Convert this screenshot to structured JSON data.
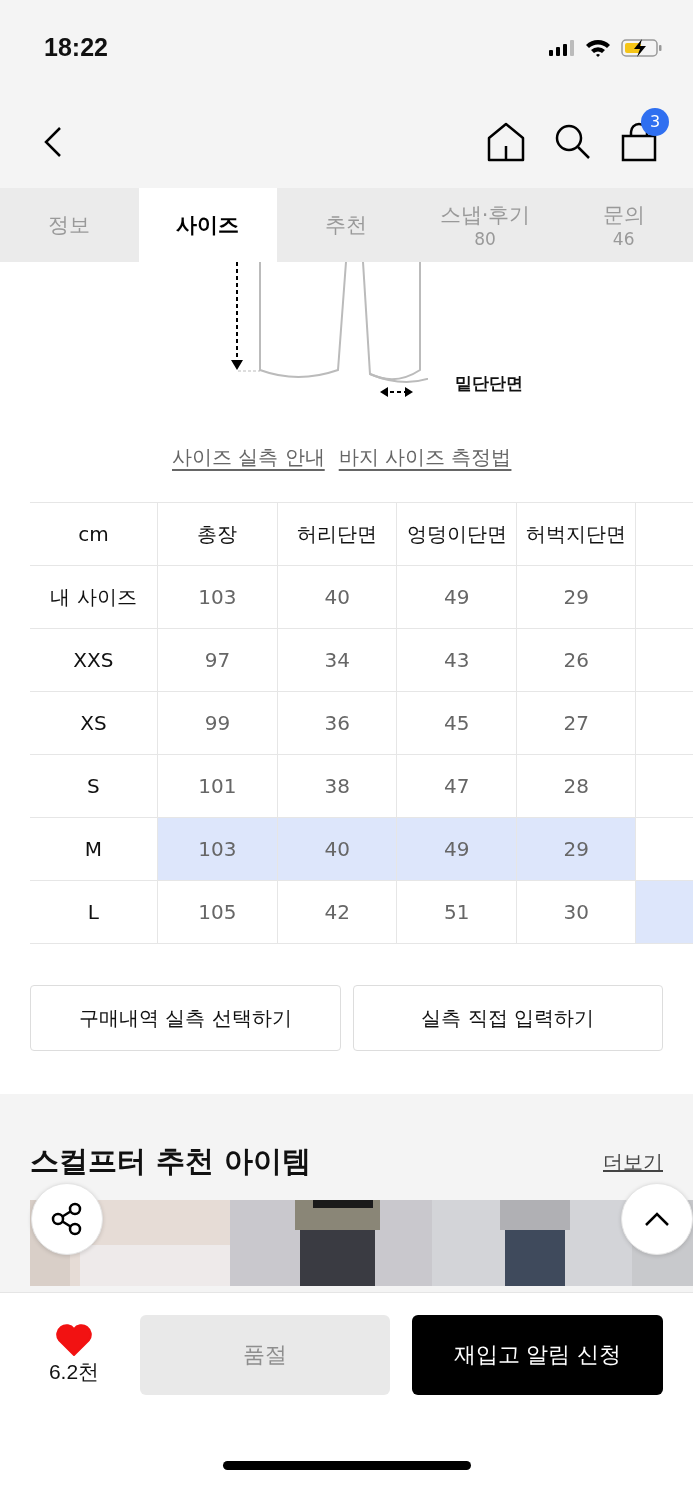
{
  "status_bar": {
    "time": "18:22"
  },
  "nav": {
    "cart_count": "3"
  },
  "tabs": [
    {
      "label": "정보",
      "selected": false
    },
    {
      "label": "사이즈",
      "selected": true
    },
    {
      "label": "추천",
      "selected": false
    },
    {
      "label": "스냅·후기",
      "count": "80",
      "selected": false
    },
    {
      "label": "문의",
      "count": "46",
      "selected": false
    }
  ],
  "diagram": {
    "label": "밑단단면"
  },
  "links": [
    "사이즈 실측 안내",
    "바지 사이즈 측정법"
  ],
  "size_table": {
    "columns": [
      "cm",
      "총장",
      "허리단면",
      "엉덩이단면",
      "허벅지단면"
    ],
    "rows": [
      {
        "label": "내 사이즈",
        "values": [
          "103",
          "40",
          "49",
          "29"
        ],
        "highlighted": false,
        "next_column_highlighted": false
      },
      {
        "label": "XXS",
        "values": [
          "97",
          "34",
          "43",
          "26"
        ],
        "highlighted": false,
        "next_column_highlighted": false
      },
      {
        "label": "XS",
        "values": [
          "99",
          "36",
          "45",
          "27"
        ],
        "highlighted": false,
        "next_column_highlighted": false
      },
      {
        "label": "S",
        "values": [
          "101",
          "38",
          "47",
          "28"
        ],
        "highlighted": false,
        "next_column_highlighted": false
      },
      {
        "label": "M",
        "values": [
          "103",
          "40",
          "49",
          "29"
        ],
        "highlighted": true,
        "next_column_highlighted": false
      },
      {
        "label": "L",
        "values": [
          "105",
          "42",
          "51",
          "30"
        ],
        "highlighted": false,
        "next_column_highlighted": true
      }
    ]
  },
  "actions": [
    "구매내역 실측 선택하기",
    "실측 직접 입력하기"
  ],
  "recommend": {
    "title": "스컬프터 추천 아이템",
    "more": "더보기"
  },
  "bottom_bar": {
    "likes": "6.2천",
    "liked": true,
    "sold_out": "품절",
    "restock": "재입고 알림 신청"
  }
}
